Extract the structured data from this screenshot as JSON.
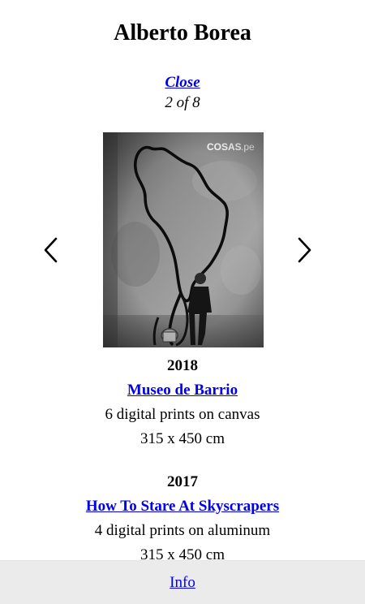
{
  "header": {
    "title": "Alberto Borea"
  },
  "gallery": {
    "close_label": "Close",
    "counter": "2 of 8",
    "image_watermark": "COSAS.pe"
  },
  "works": [
    {
      "year": "2018",
      "title": "Museo de Barrio",
      "description": "6 digital prints on canvas",
      "dimensions": "315 x 450 cm"
    },
    {
      "year": "2017",
      "title": "How To Stare At Skyscrapers",
      "description": "4 digital prints on aluminum",
      "dimensions": "315 x 450 cm"
    }
  ],
  "footer": {
    "info_label": "Info"
  },
  "icons": {
    "prev": "chevron-left-icon",
    "next": "chevron-right-icon"
  }
}
